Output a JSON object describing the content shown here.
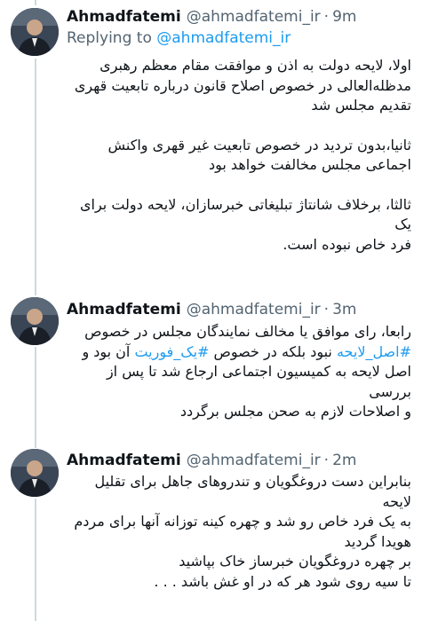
{
  "tweets": [
    {
      "author_name": "Ahmadfatemi",
      "handle": "@ahmadfatemi_ir",
      "time": "9m",
      "replying_prefix": "Replying to",
      "replying_handle": "@ahmadfatemi_ir",
      "paragraphs": [
        {
          "lines": [
            "اولا، لایحه دولت به اذن و موافقت مقام معظم رهبری",
            "مدظله‌العالی در خصوص اصلاح قانون درباره تابعیت قهری",
            "تقدیم مجلس شد"
          ]
        },
        {
          "lines": [
            "ثانیا،بدون تردید در خصوص تابعیت غیر قهری واکنش",
            "اجماعی مجلس مخالفت خواهد بود"
          ]
        },
        {
          "lines": [
            "ثالثا، برخلاف شانتاژ تبلیغاتی خبرسازان، لایحه دولت برای یک",
            "فرد خاص نبوده است."
          ]
        }
      ]
    },
    {
      "author_name": "Ahmadfatemi",
      "handle": "@ahmadfatemi_ir",
      "time": "3m",
      "line1": "رابعا، رای موافق یا مخالف نمایندگان مجلس در خصوص",
      "hashtag1": "#اصل_لایحه",
      "mid_text": " نبود بلکه در خصوص ",
      "hashtag2": "#یک_فوریت",
      "end_text": " آن بود و",
      "line3": "اصل لایحه به کمیسیون اجتماعی ارجاع شد تا پس از بررسی",
      "line4": "و اصلاحات لازم به صحن مجلس برگردد"
    },
    {
      "author_name": "Ahmadfatemi",
      "handle": "@ahmadfatemi_ir",
      "time": "2m",
      "lines": [
        "بنابراین دست دروغگویان و تندروهای جاهل برای تقلیل لایحه",
        "به یک فرد خاص رو شد و چهره کینه توزانه آنها برای مردم",
        "هویدا گردید",
        "بر چهره دروغگویان خبرساز خاک بپاشید",
        "تا سیه روی شود هر که در او غش باشد . . ."
      ]
    }
  ],
  "icons": {
    "avatar": "user-avatar-photo"
  },
  "colors": {
    "link": "#1d9bf0",
    "secondary_text": "#536471",
    "thread_line": "#cfd9de"
  }
}
